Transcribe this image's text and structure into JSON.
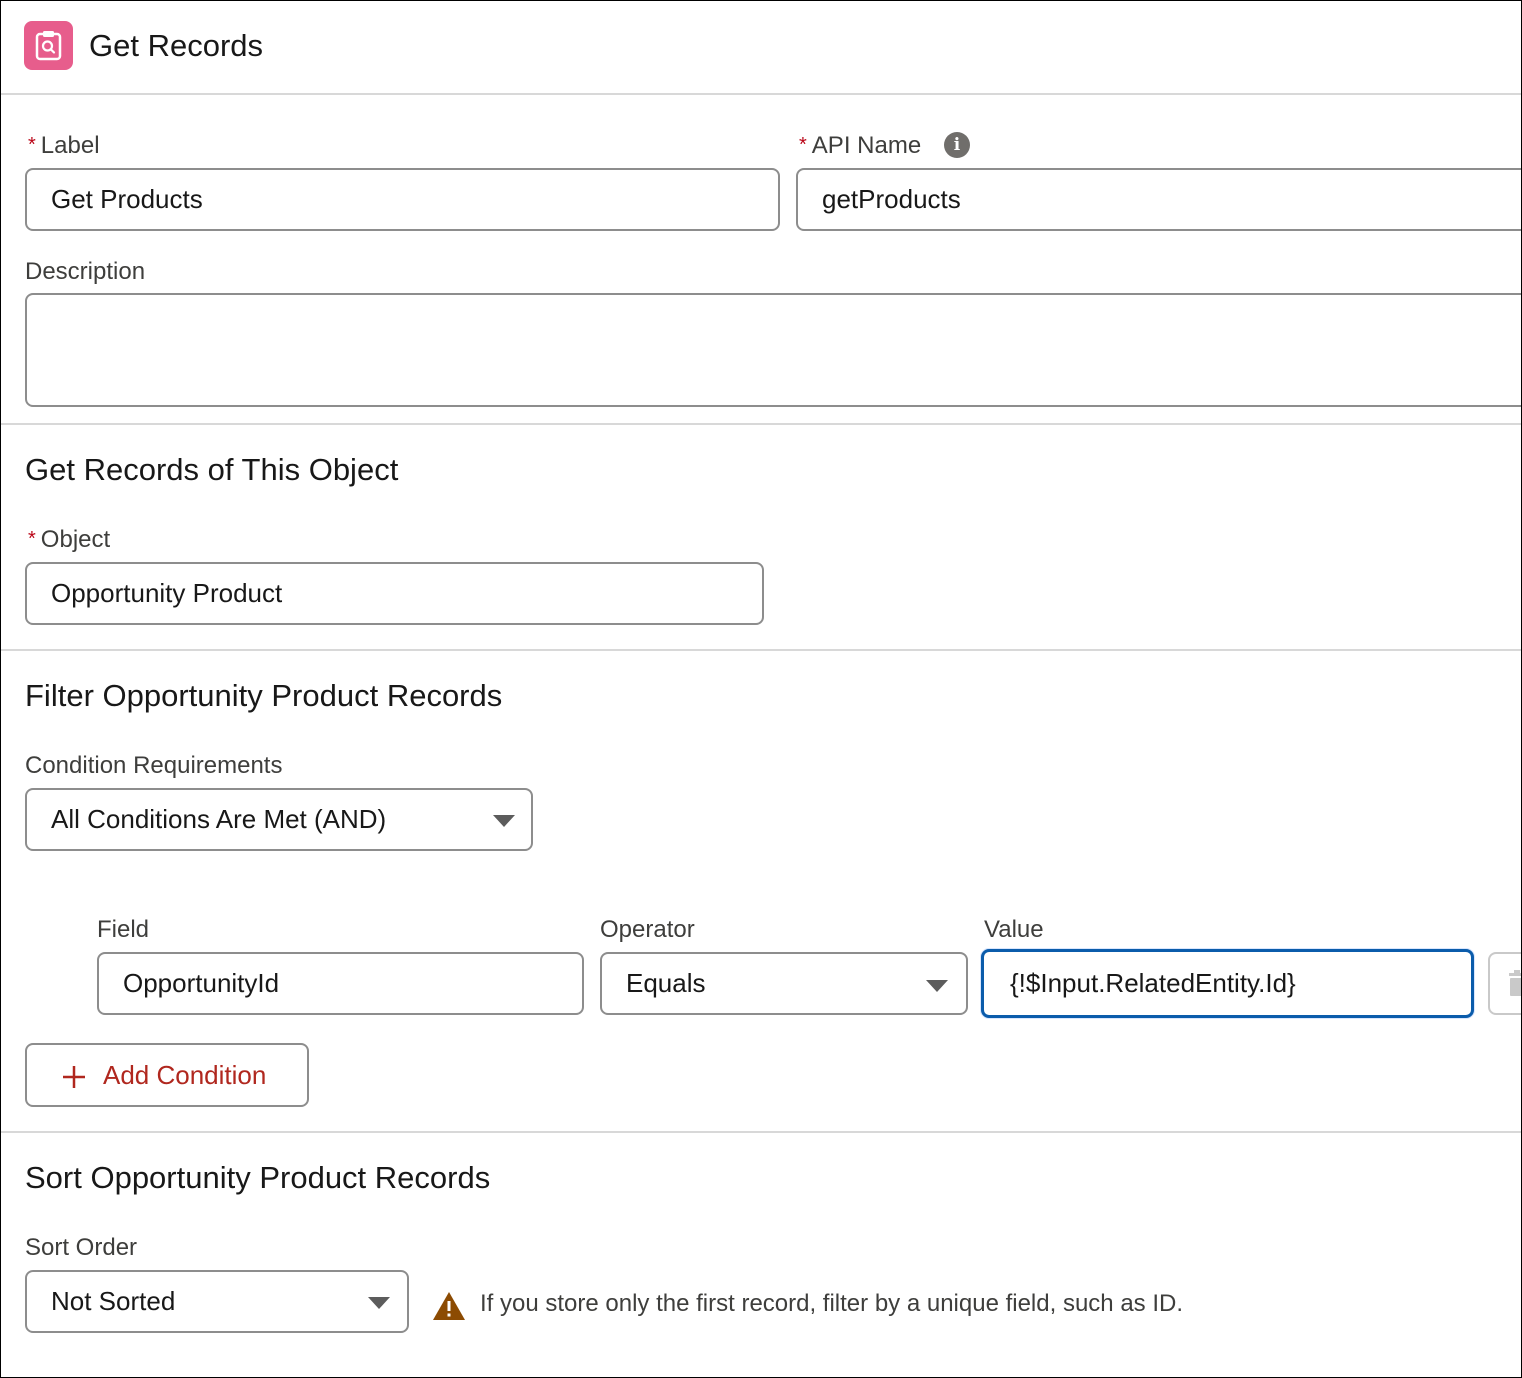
{
  "header": {
    "title": "Get Records",
    "icon": "get-records-icon",
    "icon_color": "#e75d8c"
  },
  "details": {
    "label_field": {
      "label": "Label",
      "value": "Get Products"
    },
    "api_name_field": {
      "label": "API Name",
      "value": "getProducts"
    },
    "description_field": {
      "label": "Description",
      "value": ""
    },
    "required_marker": "*"
  },
  "object_section": {
    "heading": "Get Records of This Object",
    "object_field": {
      "label": "Object",
      "value": "Opportunity Product"
    }
  },
  "filter_section": {
    "heading": "Filter Opportunity Product Records",
    "condition_requirements": {
      "label": "Condition Requirements",
      "value": "All Conditions Are Met (AND)"
    },
    "columns": {
      "field": "Field",
      "operator": "Operator",
      "value": "Value"
    },
    "condition": {
      "field": "OpportunityId",
      "operator": "Equals",
      "value": "{!$Input.RelatedEntity.Id}"
    },
    "add_condition_label": "Add Condition",
    "accent_color": "#b0271e"
  },
  "sort_section": {
    "heading": "Sort Opportunity Product Records",
    "sort_order": {
      "label": "Sort Order",
      "value": "Not Sorted"
    },
    "warning_text": "If you store only the first record, filter by a unique field, such as ID.",
    "warning_color": "#8c4b02"
  },
  "focus_color": "#0b5cab"
}
